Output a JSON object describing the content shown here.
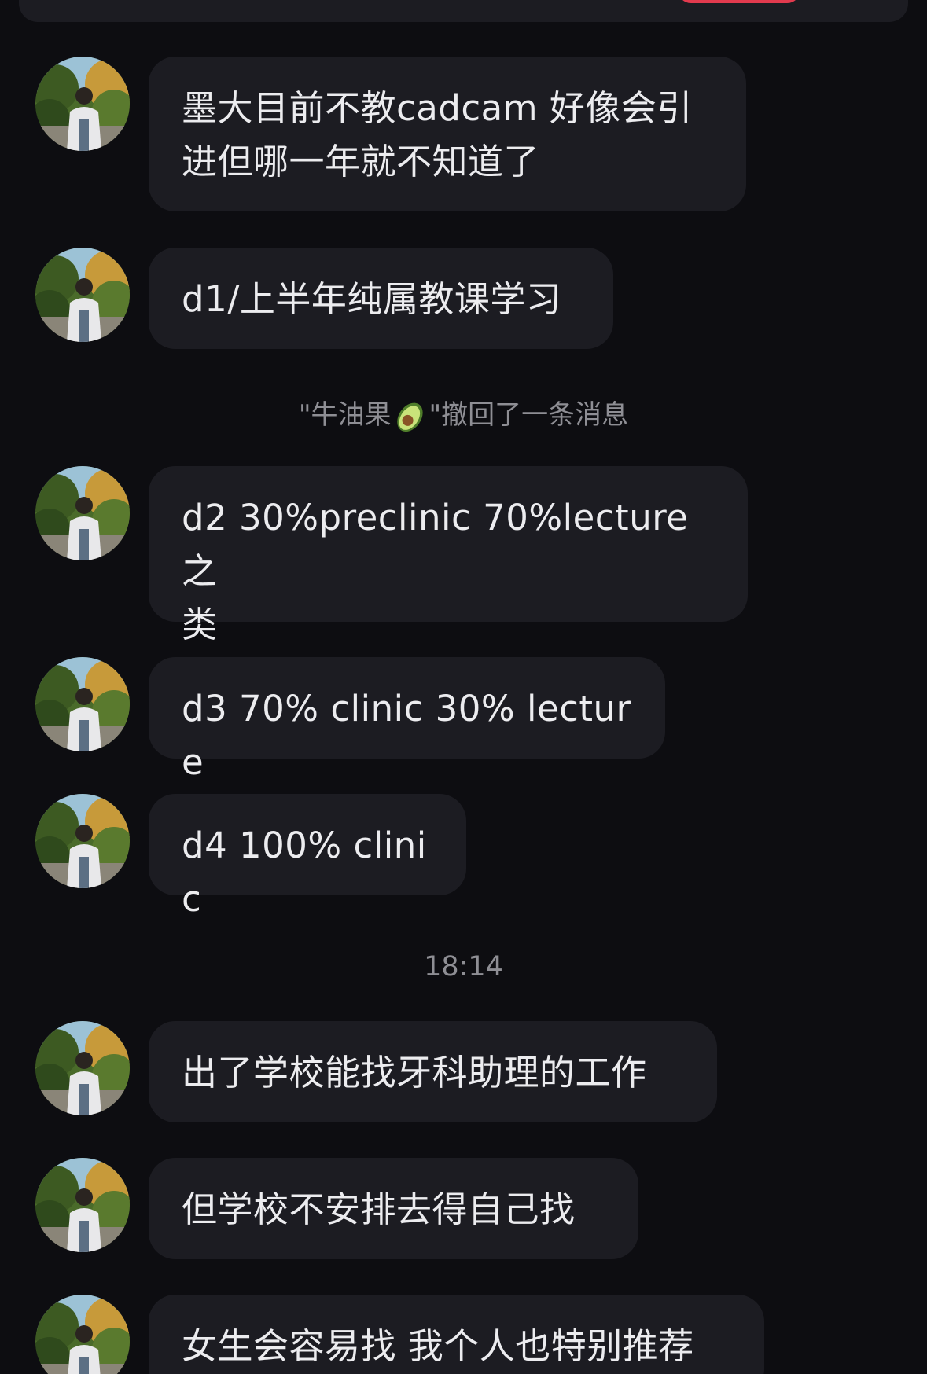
{
  "messages_before_notice": [
    {
      "text": "墨大目前不教cadcam 好像会引\n进但哪一年就不知道了"
    },
    {
      "text": "d1/上半年纯属教课学习"
    }
  ],
  "recall_notice": {
    "prefix": "\"牛油果",
    "suffix": "\"撤回了一条消息",
    "emoji_icon": "avocado-icon"
  },
  "messages_after_notice": [
    {
      "text": "d2 30%preclinic 70%lecture 之\n类"
    },
    {
      "text": "d3 70% clinic 30% lecture"
    },
    {
      "text": "d4 100% clinic"
    }
  ],
  "timestamp": "18:14",
  "messages_after_time": [
    {
      "text": "出了学校能找牙科助理的工作"
    },
    {
      "text": "但学校不安排去得自己找"
    },
    {
      "text": "女生会容易找 我个人也特别推荐"
    }
  ],
  "colors": {
    "background": "#0d0d11",
    "bubble": "#1c1c22",
    "text": "#ececef",
    "muted": "#8e8e94",
    "accent_red": "#e23a4e"
  }
}
